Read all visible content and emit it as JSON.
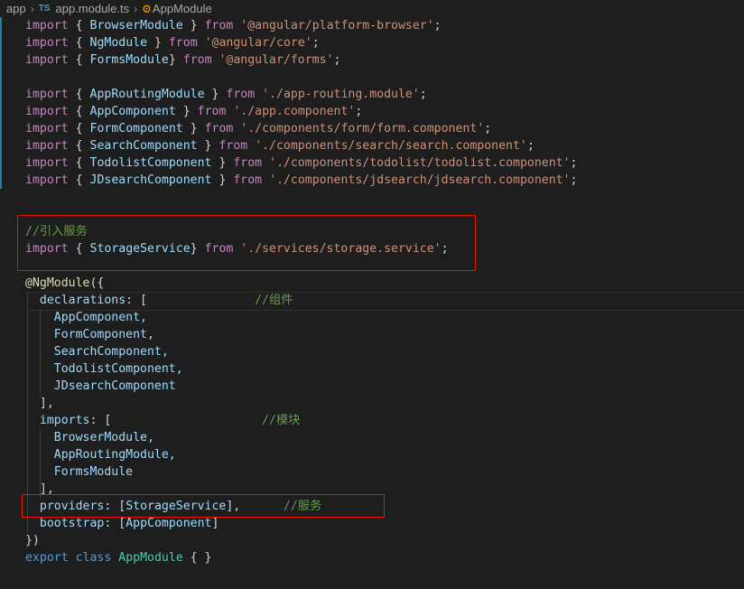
{
  "breadcrumb": {
    "folder": "app",
    "lang_badge": "TS",
    "file": "app.module.ts",
    "symbol": "AppModule"
  },
  "code": {
    "l1": [
      "import",
      "{",
      "BrowserModule",
      "}",
      "from",
      "'@angular/platform-browser'",
      ";"
    ],
    "l2": [
      "import",
      "{",
      "NgModule",
      "}",
      "from",
      "'@angular/core'",
      ";"
    ],
    "l3": [
      "import",
      "{",
      "FormsModule",
      "}",
      "from",
      "'@angular/forms'",
      ";"
    ],
    "l5": [
      "import",
      "{",
      "AppRoutingModule",
      "}",
      "from",
      "'./app-routing.module'",
      ";"
    ],
    "l6": [
      "import",
      "{",
      "AppComponent",
      "}",
      "from",
      "'./app.component'",
      ";"
    ],
    "l7": [
      "import",
      "{",
      "FormComponent",
      "}",
      "from",
      "'./components/form/form.component'",
      ";"
    ],
    "l8": [
      "import",
      "{",
      "SearchComponent",
      "}",
      "from",
      "'./components/search/search.component'",
      ";"
    ],
    "l9": [
      "import",
      "{",
      "TodolistComponent",
      "}",
      "from",
      "'./components/todolist/todolist.component'",
      ";"
    ],
    "l10": [
      "import",
      "{",
      "JDsearchComponent",
      "}",
      "from",
      "'./components/jdsearch/jdsearch.component'",
      ";"
    ],
    "l13": "//引入服务",
    "l14": [
      "import",
      "{",
      "StorageService",
      "}",
      "from",
      "'./services/storage.service'",
      ";"
    ],
    "l16": [
      "@",
      "NgModule",
      "({"
    ],
    "l17": [
      "declarations",
      ": [",
      "//组件"
    ],
    "l18": "AppComponent,",
    "l19": "FormComponent,",
    "l20": "SearchComponent,",
    "l21": "TodolistComponent,",
    "l22": "JDsearchComponent",
    "l23": "],",
    "l24": [
      "imports",
      ": [",
      "//模块"
    ],
    "l25": "BrowserModule,",
    "l26": "AppRoutingModule,",
    "l27": "FormsModule",
    "l28": "],",
    "l29": [
      "providers",
      ": [",
      "StorageService",
      "],",
      "//服务"
    ],
    "l30": [
      "bootstrap",
      ": [",
      "AppComponent",
      "]"
    ],
    "l31": "})",
    "l32": [
      "export",
      "class",
      "AppModule",
      "{ }"
    ]
  },
  "colors": {
    "highlight_box": "#e51400",
    "keyword": "#569cd6",
    "import_keyword": "#c586c0",
    "string": "#ce9178",
    "comment": "#6a9955"
  }
}
